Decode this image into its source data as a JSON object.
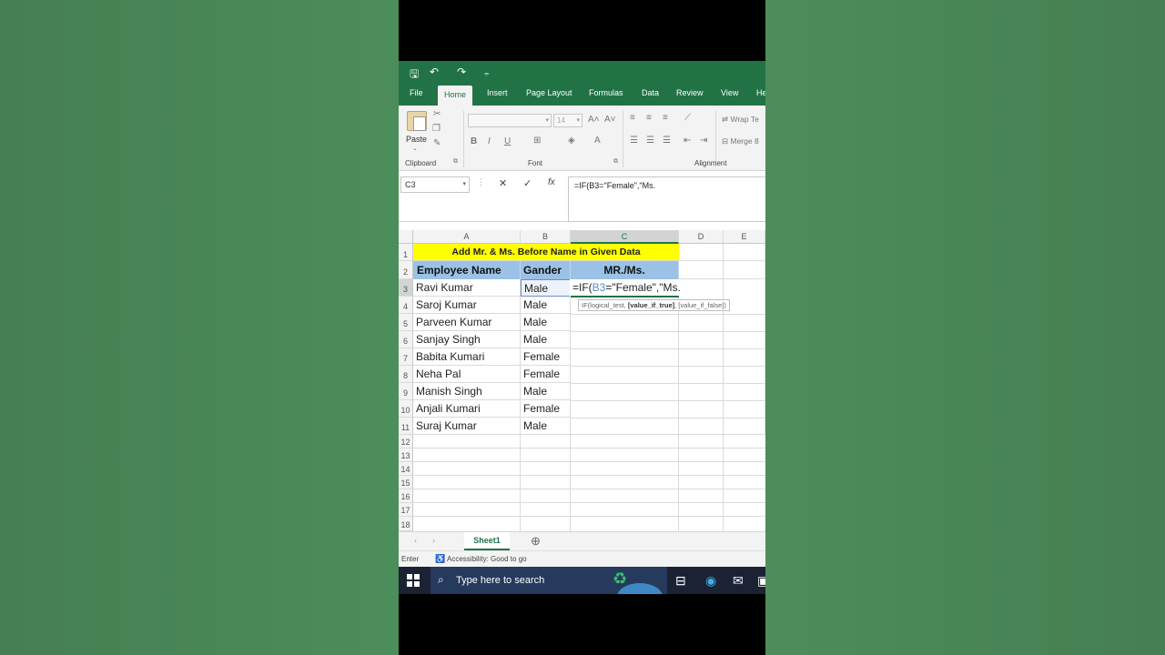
{
  "quick_access": {
    "save": "🖫",
    "undo": "↶",
    "redo": "↷",
    "more": "⩦"
  },
  "tabs": [
    {
      "label": "File",
      "active": false
    },
    {
      "label": "Home",
      "active": true
    },
    {
      "label": "Insert",
      "active": false
    },
    {
      "label": "Page Layout",
      "active": false
    },
    {
      "label": "Formulas",
      "active": false
    },
    {
      "label": "Data",
      "active": false
    },
    {
      "label": "Review",
      "active": false
    },
    {
      "label": "View",
      "active": false
    },
    {
      "label": "He",
      "active": false
    }
  ],
  "ribbon": {
    "paste_label": "Paste",
    "clipboard_label": "Clipboard",
    "font_label": "Font",
    "alignment_label": "Alignment",
    "font_size": "14",
    "wrap_text": "Wrap Te",
    "merge": "Merge 8"
  },
  "formula_bar": {
    "name_box": "C3",
    "formula": "=IF(B3=\"Female\",\"Ms."
  },
  "columns": [
    {
      "label": "",
      "selected": false
    },
    {
      "label": "A",
      "selected": false
    },
    {
      "label": "B",
      "selected": false
    },
    {
      "label": "C",
      "selected": true
    },
    {
      "label": "D",
      "selected": false
    },
    {
      "label": "E",
      "selected": false
    }
  ],
  "rows": [
    "1",
    "2",
    "3",
    "4",
    "5",
    "6",
    "7",
    "8",
    "9",
    "10",
    "11",
    "12",
    "13",
    "14",
    "15",
    "16",
    "17",
    "18"
  ],
  "sheet": {
    "title": "Add Mr. & Ms. Before Name in Given Data",
    "headers": {
      "name": "Employee Name",
      "gender": "Gander",
      "prefix": "MR./Ms."
    },
    "records": [
      {
        "name": "Ravi Kumar",
        "gender": "Male"
      },
      {
        "name": "Saroj Kumar",
        "gender": "Male"
      },
      {
        "name": "Parveen Kumar",
        "gender": "Male"
      },
      {
        "name": "Sanjay Singh",
        "gender": "Male"
      },
      {
        "name": "Babita Kumari",
        "gender": "Female"
      },
      {
        "name": "Neha Pal",
        "gender": "Female"
      },
      {
        "name": "Manish Singh",
        "gender": "Male"
      },
      {
        "name": "Anjali Kumari",
        "gender": "Female"
      },
      {
        "name": "Suraj Kumar",
        "gender": "Male"
      }
    ],
    "editing": {
      "prefix": "=IF(",
      "ref": "B3",
      "rest": "=\"Female\",\"Ms."
    },
    "tooltip": {
      "part1": "IF(logical_test, ",
      "bold": "[value_if_true]",
      "part2": ", [value_if_false])"
    }
  },
  "sheet_tab": "Sheet1",
  "status": {
    "mode": "Enter",
    "accessibility": "Accessibility: Good to go"
  },
  "taskbar": {
    "search_placeholder": "Type here to search"
  },
  "colors": {
    "excel_green": "#217346",
    "title_fill": "#ffff00",
    "header_fill": "#9bc2e6",
    "taskbar": "#1b2233"
  }
}
